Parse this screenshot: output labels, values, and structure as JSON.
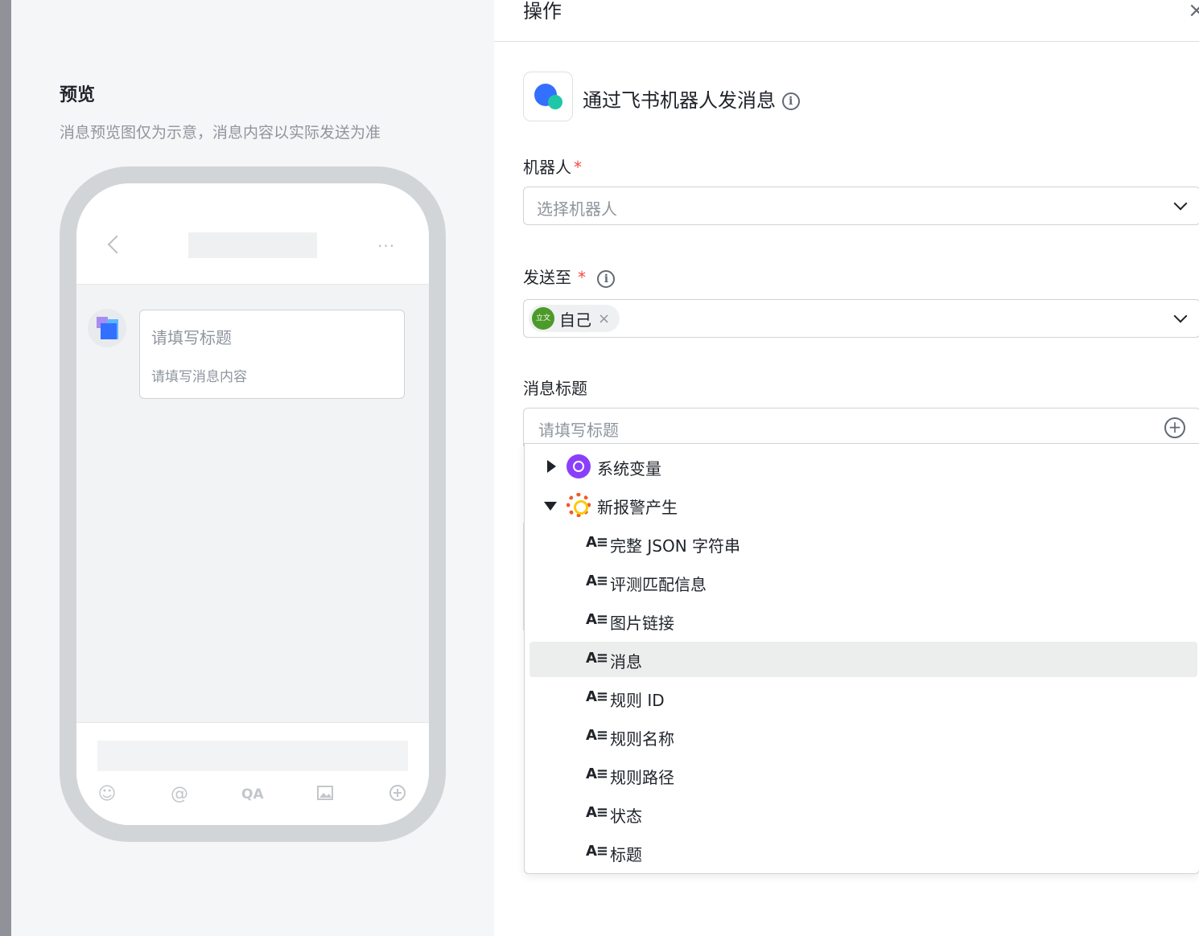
{
  "preview": {
    "title": "预览",
    "subtitle": "消息预览图仅为示意，消息内容以实际发送为准",
    "card_title": "请填写标题",
    "card_content": "请填写消息内容",
    "more_glyph": "···",
    "footer_icons": [
      "smile-icon",
      "at-icon",
      "qa-icon",
      "image-icon",
      "plus-icon"
    ],
    "qa_glyph": "QA"
  },
  "panel": {
    "title": "操作",
    "close_glyph": "×",
    "action_title": "通过飞书机器人发消息",
    "info_glyph": "i"
  },
  "form": {
    "robot": {
      "label": "机器人",
      "required": "*",
      "placeholder": "选择机器人"
    },
    "send_to": {
      "label": "发送至",
      "required": "*",
      "tag_avatar": "立文",
      "tag_text": "自己",
      "tag_close": "×"
    },
    "message_title": {
      "label": "消息标题",
      "placeholder": "请填写标题",
      "add_glyph": "+"
    }
  },
  "dropdown": {
    "groups": [
      {
        "label": "系统变量",
        "expanded": false
      },
      {
        "label": "新报警产生",
        "expanded": true
      }
    ],
    "leaf_icon": "A≡",
    "items": [
      "完整 JSON 字符串",
      "评测匹配信息",
      "图片链接",
      "消息",
      "规则 ID",
      "规则名称",
      "规则路径",
      "状态",
      "标题"
    ],
    "highlighted": "消息"
  },
  "colors": {
    "accent": "#3370ff",
    "required": "#f54a45",
    "system_var": "#8a3ffc",
    "grafana": "#f05a28",
    "highlight_row": "#eceded"
  }
}
